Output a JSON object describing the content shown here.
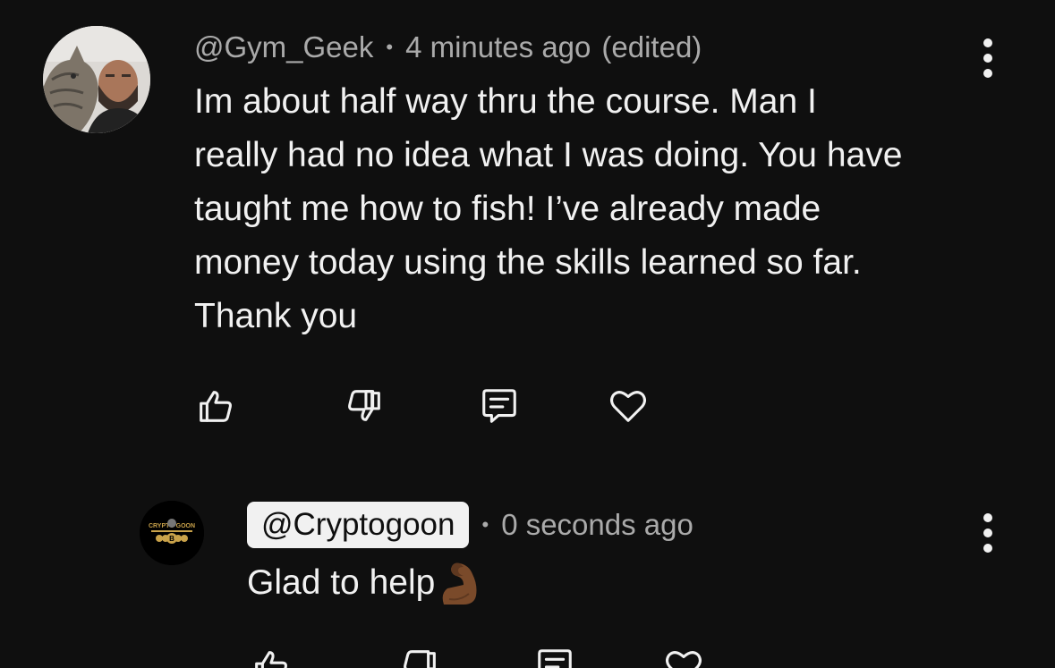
{
  "comment": {
    "author_handle": "@Gym_Geek",
    "separator": "•",
    "time_ago": "4 minutes ago",
    "edited_label": "(edited)",
    "text": "Im about half way thru the course. Man I\nreally had no idea what I was doing. You have\ntaught me how to fish! I’ve already made\nmoney today using the skills learned so far.\nThank you",
    "avatar_icon": "user-with-cat-photo",
    "actions": [
      "like-icon",
      "dislike-icon",
      "reply-icon",
      "heart-icon"
    ],
    "menu_icon": "more-vertical-icon"
  },
  "reply": {
    "author_handle": "@Cryptogoon",
    "separator": "•",
    "time_ago": "0 seconds ago",
    "text": "Glad to help",
    "emoji": "flexed-biceps-emoji",
    "avatar_icon": "cryptogoon-logo",
    "avatar_logo_text": "CRYPTO GOON",
    "avatar_logo_letter": "B",
    "actions": [
      "like-icon",
      "dislike-icon",
      "reply-icon",
      "heart-icon"
    ],
    "menu_icon": "more-vertical-icon"
  },
  "colors": {
    "background": "#0f0f0f",
    "primary_text": "#f1f1f1",
    "secondary_text": "#aaaaaa",
    "pill_background": "#f1f1f1",
    "logo_gold": "#c9a24a"
  }
}
